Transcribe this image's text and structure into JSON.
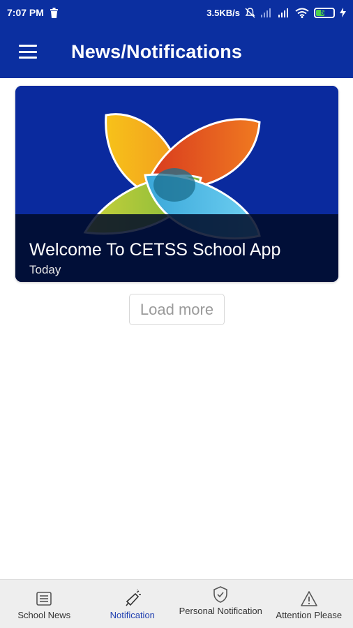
{
  "status_bar": {
    "time": "7:07 PM",
    "net_speed": "3.5KB/s",
    "battery_level": "53"
  },
  "app_bar": {
    "title": "News/Notifications"
  },
  "news": {
    "items": [
      {
        "title": "Welcome To CETSS School App",
        "date": "Today"
      }
    ],
    "load_more_label": "Load more"
  },
  "bottom_nav": {
    "items": [
      {
        "label": "School News",
        "icon": "newspaper-icon"
      },
      {
        "label": "Notification",
        "icon": "megaphone-icon",
        "active": true
      },
      {
        "label": "Personal Notification",
        "icon": "shield-icon"
      },
      {
        "label": "Attention Please",
        "icon": "warning-icon"
      }
    ]
  },
  "colors": {
    "primary": "#0b2fa0",
    "active_nav": "#1f3fb0",
    "nav_background": "#eeeeee"
  }
}
